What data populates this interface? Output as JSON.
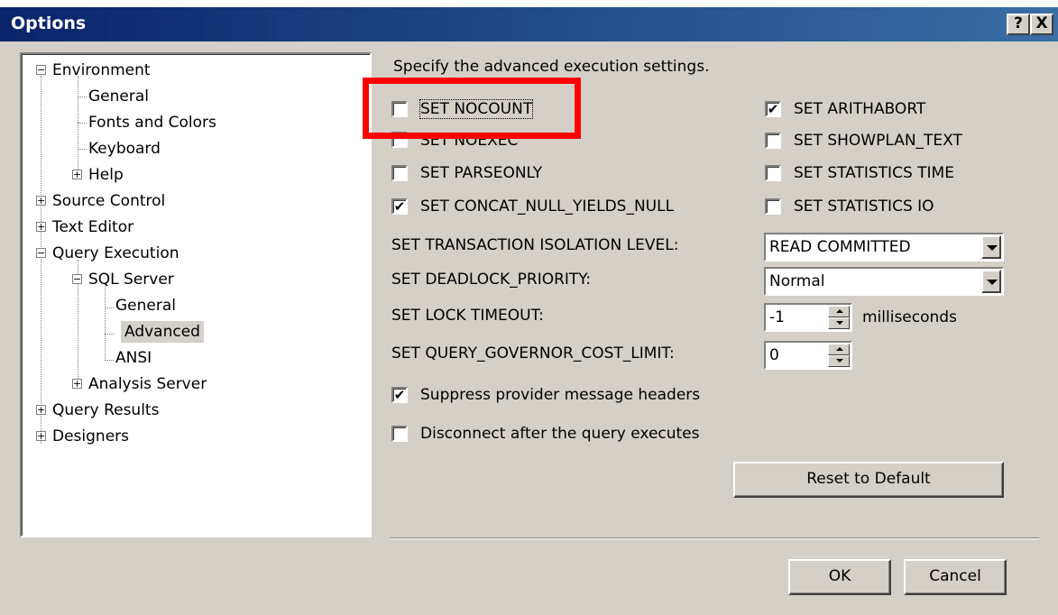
{
  "window": {
    "title": "Options",
    "help_button": "?",
    "close_button": "X"
  },
  "tree": {
    "environment": "Environment",
    "general": "General",
    "fonts_and_colors": "Fonts and Colors",
    "keyboard": "Keyboard",
    "help": "Help",
    "source_control": "Source Control",
    "text_editor": "Text Editor",
    "query_execution": "Query Execution",
    "sql_server": "SQL Server",
    "sql_general": "General",
    "sql_advanced": "Advanced",
    "sql_ansi": "ANSI",
    "analysis_server": "Analysis Server",
    "query_results": "Query Results",
    "designers": "Designers",
    "selected": "Advanced"
  },
  "panel": {
    "heading": "Specify the advanced execution settings.",
    "set_nocount": {
      "label": "SET NOCOUNT",
      "checked": false
    },
    "set_noexec": {
      "label": "SET NOEXEC",
      "checked": false
    },
    "set_parseonly": {
      "label": "SET PARSEONLY",
      "checked": false
    },
    "set_concat": {
      "label": "SET CONCAT_NULL_YIELDS_NULL",
      "checked": true
    },
    "set_arithabort": {
      "label": "SET ARITHABORT",
      "checked": true
    },
    "set_showplan": {
      "label": "SET SHOWPLAN_TEXT",
      "checked": false
    },
    "set_stat_time": {
      "label": "SET STATISTICS TIME",
      "checked": false
    },
    "set_stat_io": {
      "label": "SET STATISTICS IO",
      "checked": false
    },
    "isolation_label": "SET TRANSACTION ISOLATION LEVEL:",
    "isolation_value": "READ COMMITTED",
    "deadlock_label": "SET DEADLOCK_PRIORITY:",
    "deadlock_value": "Normal",
    "lock_timeout_label": "SET LOCK TIMEOUT:",
    "lock_timeout_value": "-1",
    "lock_timeout_unit": "milliseconds",
    "governor_label": "SET QUERY_GOVERNOR_COST_LIMIT:",
    "governor_value": "0",
    "suppress_headers": {
      "label": "Suppress provider message headers",
      "checked": true
    },
    "disconnect": {
      "label": "Disconnect after the query executes",
      "checked": false
    },
    "reset_button": "Reset to Default"
  },
  "footer": {
    "ok": "OK",
    "cancel": "Cancel"
  },
  "check_mark": "✔",
  "colors": {
    "highlight_box": "#ff0000",
    "title_bar": "#0a246a",
    "dialog_bg": "#d4d0c8"
  }
}
